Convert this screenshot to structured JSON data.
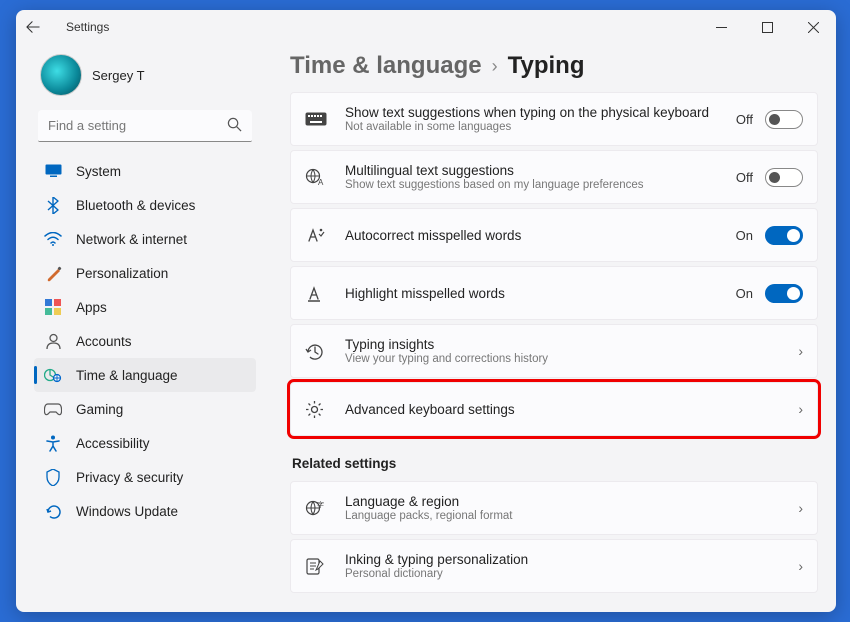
{
  "window": {
    "title": "Settings"
  },
  "profile": {
    "name": "Sergey T"
  },
  "search": {
    "placeholder": "Find a setting"
  },
  "nav": {
    "items": [
      {
        "key": "system",
        "label": "System",
        "icon": "display-icon",
        "color": "#0067c0"
      },
      {
        "key": "bluetooth",
        "label": "Bluetooth & devices",
        "icon": "bluetooth-icon",
        "color": "#0067c0"
      },
      {
        "key": "network",
        "label": "Network & internet",
        "icon": "wifi-icon",
        "color": "#0067c0"
      },
      {
        "key": "personalization",
        "label": "Personalization",
        "icon": "brush-icon",
        "color": "#d16a2e"
      },
      {
        "key": "apps",
        "label": "Apps",
        "icon": "apps-icon",
        "color": "#0067c0"
      },
      {
        "key": "accounts",
        "label": "Accounts",
        "icon": "person-icon",
        "color": "#555"
      },
      {
        "key": "timelang",
        "label": "Time & language",
        "icon": "clock-globe-icon",
        "color": "#2a8",
        "active": true
      },
      {
        "key": "gaming",
        "label": "Gaming",
        "icon": "game-icon",
        "color": "#555"
      },
      {
        "key": "accessibility",
        "label": "Accessibility",
        "icon": "accessibility-icon",
        "color": "#0067c0"
      },
      {
        "key": "privacy",
        "label": "Privacy & security",
        "icon": "shield-icon",
        "color": "#0067c0"
      },
      {
        "key": "update",
        "label": "Windows Update",
        "icon": "update-icon",
        "color": "#0067c0"
      }
    ]
  },
  "breadcrumb": {
    "parent": "Time & language",
    "current": "Typing"
  },
  "settings": [
    {
      "icon": "keyboard-icon",
      "title": "Show text suggestions when typing on the physical keyboard",
      "subtitle": "Not available in some languages",
      "type": "toggle",
      "state": "off",
      "state_label": "Off"
    },
    {
      "icon": "globe-text-icon",
      "title": "Multilingual text suggestions",
      "subtitle": "Show text suggestions based on my language preferences",
      "type": "toggle",
      "state": "off",
      "state_label": "Off"
    },
    {
      "icon": "autocorrect-icon",
      "title": "Autocorrect misspelled words",
      "type": "toggle",
      "state": "on",
      "state_label": "On"
    },
    {
      "icon": "highlight-text-icon",
      "title": "Highlight misspelled words",
      "type": "toggle",
      "state": "on",
      "state_label": "On"
    },
    {
      "icon": "history-icon",
      "title": "Typing insights",
      "subtitle": "View your typing and corrections history",
      "type": "link"
    },
    {
      "icon": "gear-icon",
      "title": "Advanced keyboard settings",
      "type": "link",
      "highlighted": true
    }
  ],
  "related": {
    "heading": "Related settings",
    "items": [
      {
        "icon": "language-region-icon",
        "title": "Language & region",
        "subtitle": "Language packs, regional format",
        "type": "link"
      },
      {
        "icon": "inking-icon",
        "title": "Inking & typing personalization",
        "subtitle": "Personal dictionary",
        "type": "link"
      }
    ]
  }
}
